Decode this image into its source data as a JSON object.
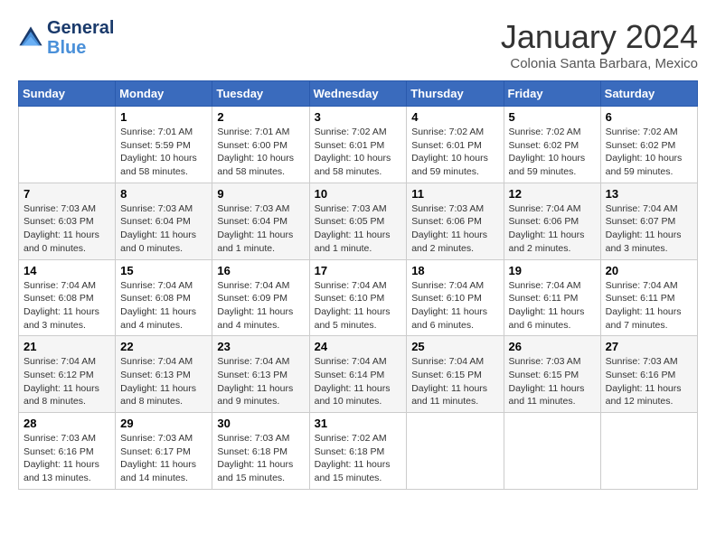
{
  "header": {
    "logo_line1": "General",
    "logo_line2": "Blue",
    "month_title": "January 2024",
    "location": "Colonia Santa Barbara, Mexico"
  },
  "days_of_week": [
    "Sunday",
    "Monday",
    "Tuesday",
    "Wednesday",
    "Thursday",
    "Friday",
    "Saturday"
  ],
  "weeks": [
    [
      {
        "day": "",
        "info": ""
      },
      {
        "day": "1",
        "info": "Sunrise: 7:01 AM\nSunset: 5:59 PM\nDaylight: 10 hours\nand 58 minutes."
      },
      {
        "day": "2",
        "info": "Sunrise: 7:01 AM\nSunset: 6:00 PM\nDaylight: 10 hours\nand 58 minutes."
      },
      {
        "day": "3",
        "info": "Sunrise: 7:02 AM\nSunset: 6:01 PM\nDaylight: 10 hours\nand 58 minutes."
      },
      {
        "day": "4",
        "info": "Sunrise: 7:02 AM\nSunset: 6:01 PM\nDaylight: 10 hours\nand 59 minutes."
      },
      {
        "day": "5",
        "info": "Sunrise: 7:02 AM\nSunset: 6:02 PM\nDaylight: 10 hours\nand 59 minutes."
      },
      {
        "day": "6",
        "info": "Sunrise: 7:02 AM\nSunset: 6:02 PM\nDaylight: 10 hours\nand 59 minutes."
      }
    ],
    [
      {
        "day": "7",
        "info": "Sunrise: 7:03 AM\nSunset: 6:03 PM\nDaylight: 11 hours\nand 0 minutes."
      },
      {
        "day": "8",
        "info": "Sunrise: 7:03 AM\nSunset: 6:04 PM\nDaylight: 11 hours\nand 0 minutes."
      },
      {
        "day": "9",
        "info": "Sunrise: 7:03 AM\nSunset: 6:04 PM\nDaylight: 11 hours\nand 1 minute."
      },
      {
        "day": "10",
        "info": "Sunrise: 7:03 AM\nSunset: 6:05 PM\nDaylight: 11 hours\nand 1 minute."
      },
      {
        "day": "11",
        "info": "Sunrise: 7:03 AM\nSunset: 6:06 PM\nDaylight: 11 hours\nand 2 minutes."
      },
      {
        "day": "12",
        "info": "Sunrise: 7:04 AM\nSunset: 6:06 PM\nDaylight: 11 hours\nand 2 minutes."
      },
      {
        "day": "13",
        "info": "Sunrise: 7:04 AM\nSunset: 6:07 PM\nDaylight: 11 hours\nand 3 minutes."
      }
    ],
    [
      {
        "day": "14",
        "info": "Sunrise: 7:04 AM\nSunset: 6:08 PM\nDaylight: 11 hours\nand 3 minutes."
      },
      {
        "day": "15",
        "info": "Sunrise: 7:04 AM\nSunset: 6:08 PM\nDaylight: 11 hours\nand 4 minutes."
      },
      {
        "day": "16",
        "info": "Sunrise: 7:04 AM\nSunset: 6:09 PM\nDaylight: 11 hours\nand 4 minutes."
      },
      {
        "day": "17",
        "info": "Sunrise: 7:04 AM\nSunset: 6:10 PM\nDaylight: 11 hours\nand 5 minutes."
      },
      {
        "day": "18",
        "info": "Sunrise: 7:04 AM\nSunset: 6:10 PM\nDaylight: 11 hours\nand 6 minutes."
      },
      {
        "day": "19",
        "info": "Sunrise: 7:04 AM\nSunset: 6:11 PM\nDaylight: 11 hours\nand 6 minutes."
      },
      {
        "day": "20",
        "info": "Sunrise: 7:04 AM\nSunset: 6:11 PM\nDaylight: 11 hours\nand 7 minutes."
      }
    ],
    [
      {
        "day": "21",
        "info": "Sunrise: 7:04 AM\nSunset: 6:12 PM\nDaylight: 11 hours\nand 8 minutes."
      },
      {
        "day": "22",
        "info": "Sunrise: 7:04 AM\nSunset: 6:13 PM\nDaylight: 11 hours\nand 8 minutes."
      },
      {
        "day": "23",
        "info": "Sunrise: 7:04 AM\nSunset: 6:13 PM\nDaylight: 11 hours\nand 9 minutes."
      },
      {
        "day": "24",
        "info": "Sunrise: 7:04 AM\nSunset: 6:14 PM\nDaylight: 11 hours\nand 10 minutes."
      },
      {
        "day": "25",
        "info": "Sunrise: 7:04 AM\nSunset: 6:15 PM\nDaylight: 11 hours\nand 11 minutes."
      },
      {
        "day": "26",
        "info": "Sunrise: 7:03 AM\nSunset: 6:15 PM\nDaylight: 11 hours\nand 11 minutes."
      },
      {
        "day": "27",
        "info": "Sunrise: 7:03 AM\nSunset: 6:16 PM\nDaylight: 11 hours\nand 12 minutes."
      }
    ],
    [
      {
        "day": "28",
        "info": "Sunrise: 7:03 AM\nSunset: 6:16 PM\nDaylight: 11 hours\nand 13 minutes."
      },
      {
        "day": "29",
        "info": "Sunrise: 7:03 AM\nSunset: 6:17 PM\nDaylight: 11 hours\nand 14 minutes."
      },
      {
        "day": "30",
        "info": "Sunrise: 7:03 AM\nSunset: 6:18 PM\nDaylight: 11 hours\nand 15 minutes."
      },
      {
        "day": "31",
        "info": "Sunrise: 7:02 AM\nSunset: 6:18 PM\nDaylight: 11 hours\nand 15 minutes."
      },
      {
        "day": "",
        "info": ""
      },
      {
        "day": "",
        "info": ""
      },
      {
        "day": "",
        "info": ""
      }
    ]
  ]
}
